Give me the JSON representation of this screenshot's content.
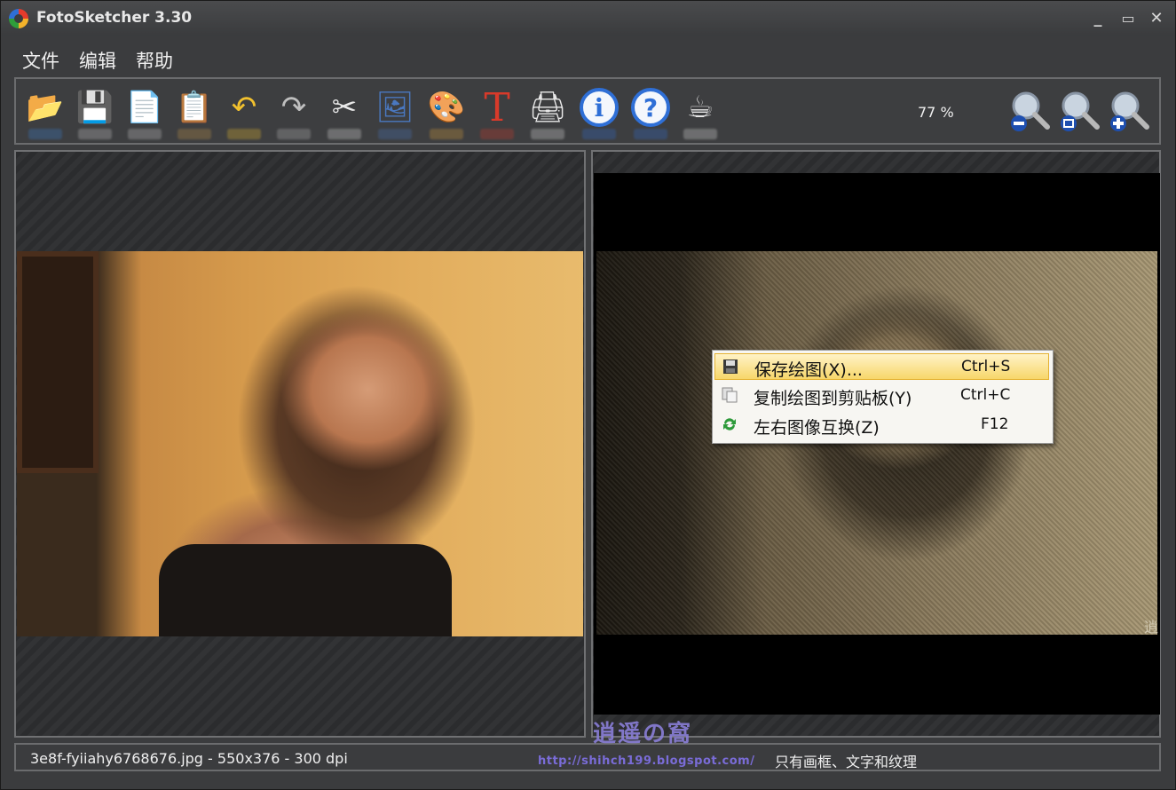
{
  "window": {
    "title": "FotoSketcher 3.30",
    "minimize": "_",
    "maximize": "▭",
    "close": "✕"
  },
  "menu": [
    "文件",
    "编辑",
    "帮助"
  ],
  "toolbar": {
    "zoom_value": "77 %",
    "tools": [
      {
        "name": "open-icon",
        "glyph": "📂",
        "color": "#3b82d6"
      },
      {
        "name": "save-icon",
        "glyph": "💾",
        "color": "#cfcfcf"
      },
      {
        "name": "copy-icon",
        "glyph": "📄",
        "color": "#cfcfcf"
      },
      {
        "name": "paste-icon",
        "glyph": "📋",
        "color": "#c89a4a"
      },
      {
        "name": "undo-icon",
        "glyph": "↶",
        "color": "#f2c12e"
      },
      {
        "name": "redo-icon",
        "glyph": "↷",
        "color": "#bfbfbf"
      },
      {
        "name": "crop-icon",
        "glyph": "✂",
        "color": "#e8e8e8"
      },
      {
        "name": "image-icon",
        "glyph": "🖼",
        "color": "#4a78c0"
      },
      {
        "name": "palette-icon",
        "glyph": "🎨",
        "color": "#e0a33a"
      },
      {
        "name": "text-icon",
        "glyph": "T",
        "color": "#d83a2a"
      },
      {
        "name": "print-icon",
        "glyph": "🖨",
        "color": "#e8e8e8"
      },
      {
        "name": "info-icon",
        "glyph": "ℹ",
        "color": "#2f6fd6"
      },
      {
        "name": "help-icon",
        "glyph": "?",
        "color": "#2f6fd6"
      },
      {
        "name": "coffee-icon",
        "glyph": "☕",
        "color": "#e8e8e8"
      }
    ],
    "zoom_tools": [
      {
        "name": "zoom-out-icon"
      },
      {
        "name": "zoom-fit-icon"
      },
      {
        "name": "zoom-in-icon"
      }
    ]
  },
  "context_menu": [
    {
      "label": "保存绘图(X)...",
      "shortcut": "Ctrl+S",
      "icon": "save-icon"
    },
    {
      "label": "复制绘图到剪贴板(Y)",
      "shortcut": "Ctrl+C",
      "icon": "copy-icon"
    },
    {
      "label": "左右图像互换(Z)",
      "shortcut": "F12",
      "icon": "swap-icon"
    }
  ],
  "status": {
    "file_info": "3e8f-fyiiahy6768676.jpg - 550x376 - 300 dpi",
    "mode": "只有画框、文字和纹理"
  },
  "watermark": {
    "logo": "逍遥の窩",
    "url": "http://shihch199.blogspot.com/",
    "corner": "逍"
  },
  "colors": {
    "accent": "#f7d76a",
    "panel_border": "#707173",
    "background": "#3b3c3e"
  }
}
